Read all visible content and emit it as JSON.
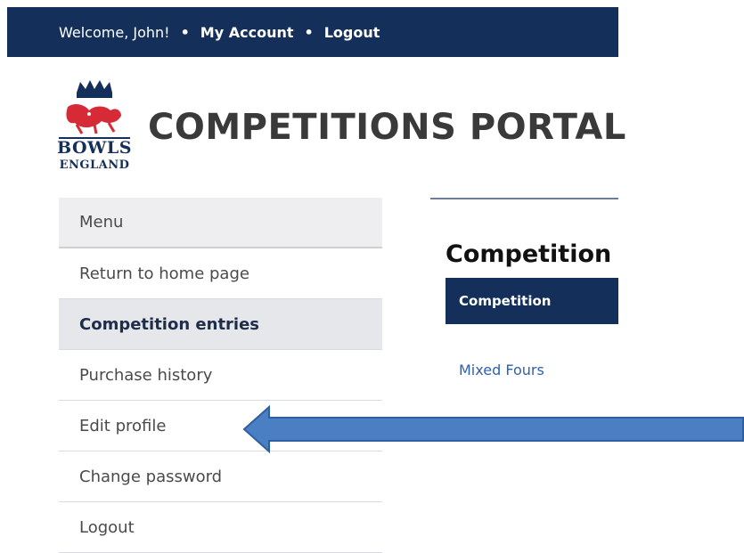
{
  "topbar": {
    "welcome": "Welcome, John!",
    "separator": "•",
    "my_account": "My Account",
    "logout": "Logout"
  },
  "logo": {
    "line1": "BOWLS",
    "line2": "ENGLAND"
  },
  "page_title": "COMPETITIONS PORTAL",
  "sidebar": {
    "items": [
      {
        "label": "Menu"
      },
      {
        "label": "Return to home page"
      },
      {
        "label": "Competition entries"
      },
      {
        "label": "Purchase history"
      },
      {
        "label": "Edit profile"
      },
      {
        "label": "Change password"
      },
      {
        "label": "Logout"
      }
    ]
  },
  "main": {
    "heading": "Competition",
    "table": {
      "header": "Competition",
      "rows": [
        {
          "competition": "Mixed Fours"
        }
      ]
    }
  },
  "colors": {
    "navy": "#14305a",
    "arrow": "#4a7fc4",
    "link": "#2e5fb3"
  },
  "icons": [
    "crown-icon",
    "lion-icon",
    "arrow-left-icon"
  ]
}
